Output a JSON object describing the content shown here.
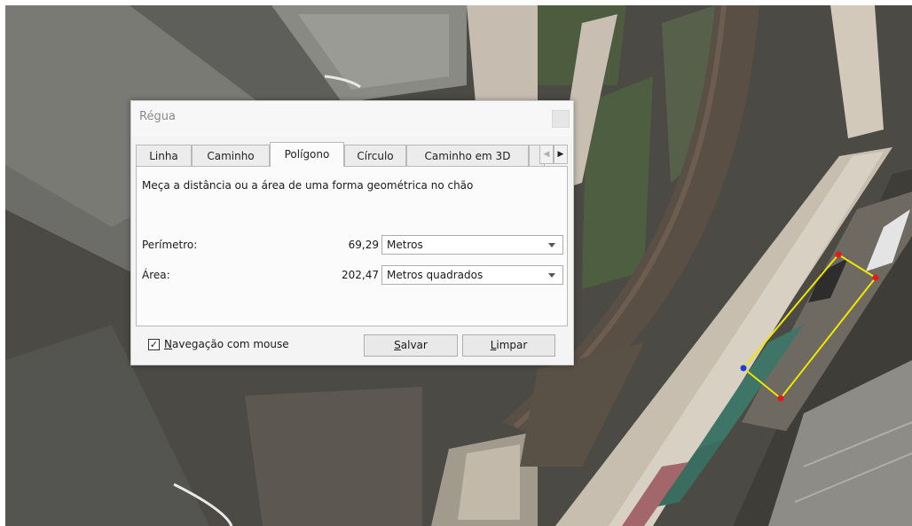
{
  "dialog": {
    "title": "Régua",
    "tabs": [
      {
        "label": "Linha",
        "active": false
      },
      {
        "label": "Caminho",
        "active": false
      },
      {
        "label": "Polígono",
        "active": true
      },
      {
        "label": "Círculo",
        "active": false
      },
      {
        "label": "Caminho em 3D",
        "active": false
      }
    ],
    "description": "Meça a distância ou a área de uma forma geométrica no chão",
    "perimeter": {
      "label": "Perímetro:",
      "value": "69,29",
      "unit": "Metros"
    },
    "area": {
      "label": "Área:",
      "value": "202,47",
      "unit": "Metros quadrados"
    },
    "mouse_navigation": {
      "checked": true,
      "label_mnemonic": "N",
      "label_rest": "avegação com mouse"
    },
    "buttons": {
      "save_mnemonic": "S",
      "save_rest": "alvar",
      "clear_mnemonic": "L",
      "clear_rest": "impar"
    }
  },
  "measurement_polygon": {
    "line_color": "#f2e600",
    "vertex_color": "#e11a1a",
    "selected_vertex_color": "#1a3ce1"
  }
}
